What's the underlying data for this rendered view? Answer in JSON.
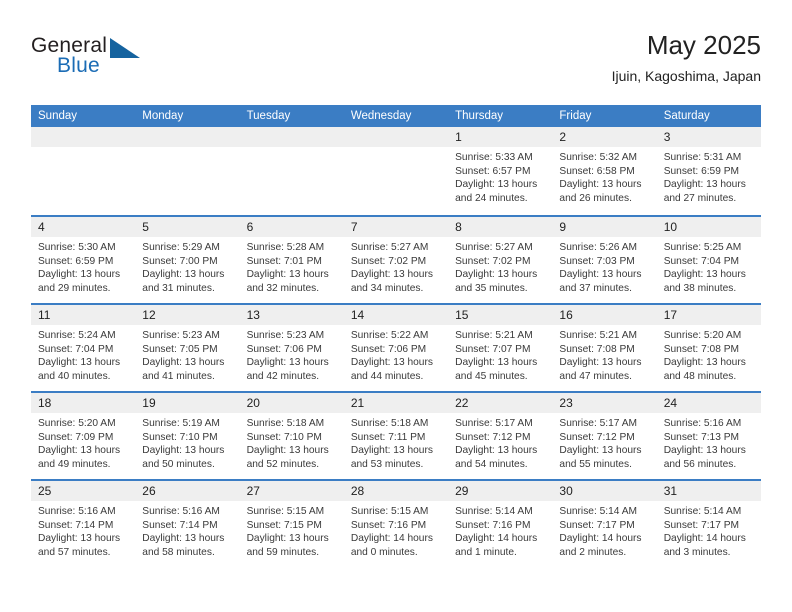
{
  "brand": {
    "word_one": "General",
    "word_two": "Blue",
    "triangle_icon": "triangle-icon",
    "accent_color": "#1b6cb5"
  },
  "header": {
    "title": "May 2025",
    "subtitle": "Ijuin, Kagoshima, Japan"
  },
  "theme": {
    "header_bar_color": "#3b7dc4",
    "date_strip_color": "#efefef",
    "row_divider_color": "#3b7dc4"
  },
  "weekdays": [
    "Sunday",
    "Monday",
    "Tuesday",
    "Wednesday",
    "Thursday",
    "Friday",
    "Saturday"
  ],
  "weeks": [
    [
      {
        "day": "",
        "sunrise": "",
        "sunset": "",
        "daylight_line1": "",
        "daylight_line2": "",
        "empty": true
      },
      {
        "day": "",
        "sunrise": "",
        "sunset": "",
        "daylight_line1": "",
        "daylight_line2": "",
        "empty": true
      },
      {
        "day": "",
        "sunrise": "",
        "sunset": "",
        "daylight_line1": "",
        "daylight_line2": "",
        "empty": true
      },
      {
        "day": "",
        "sunrise": "",
        "sunset": "",
        "daylight_line1": "",
        "daylight_line2": "",
        "empty": true
      },
      {
        "day": "1",
        "sunrise": "Sunrise: 5:33 AM",
        "sunset": "Sunset: 6:57 PM",
        "daylight_line1": "Daylight: 13 hours",
        "daylight_line2": "and 24 minutes."
      },
      {
        "day": "2",
        "sunrise": "Sunrise: 5:32 AM",
        "sunset": "Sunset: 6:58 PM",
        "daylight_line1": "Daylight: 13 hours",
        "daylight_line2": "and 26 minutes."
      },
      {
        "day": "3",
        "sunrise": "Sunrise: 5:31 AM",
        "sunset": "Sunset: 6:59 PM",
        "daylight_line1": "Daylight: 13 hours",
        "daylight_line2": "and 27 minutes."
      }
    ],
    [
      {
        "day": "4",
        "sunrise": "Sunrise: 5:30 AM",
        "sunset": "Sunset: 6:59 PM",
        "daylight_line1": "Daylight: 13 hours",
        "daylight_line2": "and 29 minutes."
      },
      {
        "day": "5",
        "sunrise": "Sunrise: 5:29 AM",
        "sunset": "Sunset: 7:00 PM",
        "daylight_line1": "Daylight: 13 hours",
        "daylight_line2": "and 31 minutes."
      },
      {
        "day": "6",
        "sunrise": "Sunrise: 5:28 AM",
        "sunset": "Sunset: 7:01 PM",
        "daylight_line1": "Daylight: 13 hours",
        "daylight_line2": "and 32 minutes."
      },
      {
        "day": "7",
        "sunrise": "Sunrise: 5:27 AM",
        "sunset": "Sunset: 7:02 PM",
        "daylight_line1": "Daylight: 13 hours",
        "daylight_line2": "and 34 minutes."
      },
      {
        "day": "8",
        "sunrise": "Sunrise: 5:27 AM",
        "sunset": "Sunset: 7:02 PM",
        "daylight_line1": "Daylight: 13 hours",
        "daylight_line2": "and 35 minutes."
      },
      {
        "day": "9",
        "sunrise": "Sunrise: 5:26 AM",
        "sunset": "Sunset: 7:03 PM",
        "daylight_line1": "Daylight: 13 hours",
        "daylight_line2": "and 37 minutes."
      },
      {
        "day": "10",
        "sunrise": "Sunrise: 5:25 AM",
        "sunset": "Sunset: 7:04 PM",
        "daylight_line1": "Daylight: 13 hours",
        "daylight_line2": "and 38 minutes."
      }
    ],
    [
      {
        "day": "11",
        "sunrise": "Sunrise: 5:24 AM",
        "sunset": "Sunset: 7:04 PM",
        "daylight_line1": "Daylight: 13 hours",
        "daylight_line2": "and 40 minutes."
      },
      {
        "day": "12",
        "sunrise": "Sunrise: 5:23 AM",
        "sunset": "Sunset: 7:05 PM",
        "daylight_line1": "Daylight: 13 hours",
        "daylight_line2": "and 41 minutes."
      },
      {
        "day": "13",
        "sunrise": "Sunrise: 5:23 AM",
        "sunset": "Sunset: 7:06 PM",
        "daylight_line1": "Daylight: 13 hours",
        "daylight_line2": "and 42 minutes."
      },
      {
        "day": "14",
        "sunrise": "Sunrise: 5:22 AM",
        "sunset": "Sunset: 7:06 PM",
        "daylight_line1": "Daylight: 13 hours",
        "daylight_line2": "and 44 minutes."
      },
      {
        "day": "15",
        "sunrise": "Sunrise: 5:21 AM",
        "sunset": "Sunset: 7:07 PM",
        "daylight_line1": "Daylight: 13 hours",
        "daylight_line2": "and 45 minutes."
      },
      {
        "day": "16",
        "sunrise": "Sunrise: 5:21 AM",
        "sunset": "Sunset: 7:08 PM",
        "daylight_line1": "Daylight: 13 hours",
        "daylight_line2": "and 47 minutes."
      },
      {
        "day": "17",
        "sunrise": "Sunrise: 5:20 AM",
        "sunset": "Sunset: 7:08 PM",
        "daylight_line1": "Daylight: 13 hours",
        "daylight_line2": "and 48 minutes."
      }
    ],
    [
      {
        "day": "18",
        "sunrise": "Sunrise: 5:20 AM",
        "sunset": "Sunset: 7:09 PM",
        "daylight_line1": "Daylight: 13 hours",
        "daylight_line2": "and 49 minutes."
      },
      {
        "day": "19",
        "sunrise": "Sunrise: 5:19 AM",
        "sunset": "Sunset: 7:10 PM",
        "daylight_line1": "Daylight: 13 hours",
        "daylight_line2": "and 50 minutes."
      },
      {
        "day": "20",
        "sunrise": "Sunrise: 5:18 AM",
        "sunset": "Sunset: 7:10 PM",
        "daylight_line1": "Daylight: 13 hours",
        "daylight_line2": "and 52 minutes."
      },
      {
        "day": "21",
        "sunrise": "Sunrise: 5:18 AM",
        "sunset": "Sunset: 7:11 PM",
        "daylight_line1": "Daylight: 13 hours",
        "daylight_line2": "and 53 minutes."
      },
      {
        "day": "22",
        "sunrise": "Sunrise: 5:17 AM",
        "sunset": "Sunset: 7:12 PM",
        "daylight_line1": "Daylight: 13 hours",
        "daylight_line2": "and 54 minutes."
      },
      {
        "day": "23",
        "sunrise": "Sunrise: 5:17 AM",
        "sunset": "Sunset: 7:12 PM",
        "daylight_line1": "Daylight: 13 hours",
        "daylight_line2": "and 55 minutes."
      },
      {
        "day": "24",
        "sunrise": "Sunrise: 5:16 AM",
        "sunset": "Sunset: 7:13 PM",
        "daylight_line1": "Daylight: 13 hours",
        "daylight_line2": "and 56 minutes."
      }
    ],
    [
      {
        "day": "25",
        "sunrise": "Sunrise: 5:16 AM",
        "sunset": "Sunset: 7:14 PM",
        "daylight_line1": "Daylight: 13 hours",
        "daylight_line2": "and 57 minutes."
      },
      {
        "day": "26",
        "sunrise": "Sunrise: 5:16 AM",
        "sunset": "Sunset: 7:14 PM",
        "daylight_line1": "Daylight: 13 hours",
        "daylight_line2": "and 58 minutes."
      },
      {
        "day": "27",
        "sunrise": "Sunrise: 5:15 AM",
        "sunset": "Sunset: 7:15 PM",
        "daylight_line1": "Daylight: 13 hours",
        "daylight_line2": "and 59 minutes."
      },
      {
        "day": "28",
        "sunrise": "Sunrise: 5:15 AM",
        "sunset": "Sunset: 7:16 PM",
        "daylight_line1": "Daylight: 14 hours",
        "daylight_line2": "and 0 minutes."
      },
      {
        "day": "29",
        "sunrise": "Sunrise: 5:14 AM",
        "sunset": "Sunset: 7:16 PM",
        "daylight_line1": "Daylight: 14 hours",
        "daylight_line2": "and 1 minute."
      },
      {
        "day": "30",
        "sunrise": "Sunrise: 5:14 AM",
        "sunset": "Sunset: 7:17 PM",
        "daylight_line1": "Daylight: 14 hours",
        "daylight_line2": "and 2 minutes."
      },
      {
        "day": "31",
        "sunrise": "Sunrise: 5:14 AM",
        "sunset": "Sunset: 7:17 PM",
        "daylight_line1": "Daylight: 14 hours",
        "daylight_line2": "and 3 minutes."
      }
    ]
  ]
}
